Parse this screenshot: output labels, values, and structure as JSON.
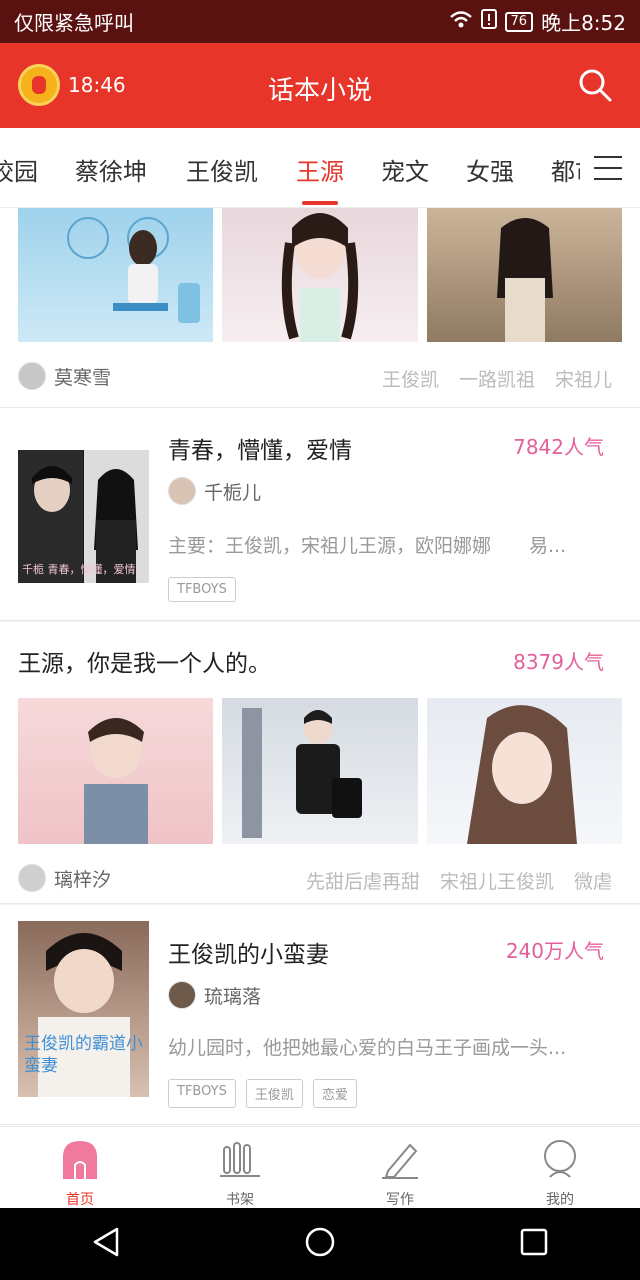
{
  "status": {
    "left_text": "仅限紧急呼叫",
    "battery": "76",
    "time": "晚上8:52"
  },
  "app": {
    "title": "话本小说",
    "timer": "18:46"
  },
  "tabs": [
    "校园",
    "蔡徐坤",
    "王俊凯",
    "王源",
    "宠文",
    "女强",
    "都市"
  ],
  "cards": [
    {
      "type": "gallery-partial",
      "author": "莫寒雪",
      "tags": [
        "王俊凯",
        "一路凯祖",
        "宋祖儿"
      ]
    },
    {
      "type": "book",
      "title": "青春，懵懂，爱情",
      "popularity": "7842人气",
      "author": "千栀儿",
      "desc": "主要：王俊凯，宋祖儿王源，欧阳娜娜　　易...",
      "badges": [
        "TFBOYS"
      ]
    },
    {
      "type": "gallery",
      "title": "王源，你是我一个人的。",
      "popularity": "8379人气",
      "author": "璃梓汐",
      "tags": [
        "先甜后虐再甜",
        "宋祖儿王俊凯",
        "微虐"
      ]
    },
    {
      "type": "book",
      "title": "王俊凯的小蛮妻",
      "popularity": "240万人气",
      "author": "琉璃落",
      "desc": "幼儿园时，他把她最心爱的白马王子画成一头...",
      "badges": [
        "TFBOYS",
        "王俊凯",
        "恋爱"
      ]
    }
  ],
  "cover_texts": {
    "book1": "千栀  青春，懵懂，爱情",
    "book2": "王俊凯的霸道小蛮妻"
  },
  "nav": [
    {
      "label": "首页",
      "icon": "home-icon"
    },
    {
      "label": "书架",
      "icon": "bookshelf-icon"
    },
    {
      "label": "写作",
      "icon": "pen-icon"
    },
    {
      "label": "我的",
      "icon": "profile-icon"
    }
  ],
  "colors": {
    "accent": "#e8352a",
    "popularity": "#e4609a",
    "statusbar": "#5a1210"
  }
}
